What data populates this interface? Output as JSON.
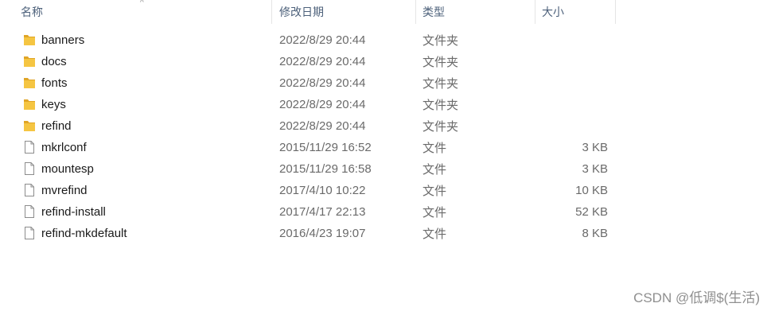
{
  "columns": {
    "name": "名称",
    "date": "修改日期",
    "type": "类型",
    "size": "大小"
  },
  "sort_indicator": "^",
  "files": [
    {
      "name": "banners",
      "date": "2022/8/29 20:44",
      "type": "文件夹",
      "size": "",
      "icon": "folder-icon"
    },
    {
      "name": "docs",
      "date": "2022/8/29 20:44",
      "type": "文件夹",
      "size": "",
      "icon": "folder-icon"
    },
    {
      "name": "fonts",
      "date": "2022/8/29 20:44",
      "type": "文件夹",
      "size": "",
      "icon": "folder-icon"
    },
    {
      "name": "keys",
      "date": "2022/8/29 20:44",
      "type": "文件夹",
      "size": "",
      "icon": "folder-icon"
    },
    {
      "name": "refind",
      "date": "2022/8/29 20:44",
      "type": "文件夹",
      "size": "",
      "icon": "folder-icon"
    },
    {
      "name": "mkrlconf",
      "date": "2015/11/29 16:52",
      "type": "文件",
      "size": "3 KB",
      "icon": "file-icon"
    },
    {
      "name": "mountesp",
      "date": "2015/11/29 16:58",
      "type": "文件",
      "size": "3 KB",
      "icon": "file-icon"
    },
    {
      "name": "mvrefind",
      "date": "2017/4/10 10:22",
      "type": "文件",
      "size": "10 KB",
      "icon": "file-icon"
    },
    {
      "name": "refind-install",
      "date": "2017/4/17 22:13",
      "type": "文件",
      "size": "52 KB",
      "icon": "file-icon"
    },
    {
      "name": "refind-mkdefault",
      "date": "2016/4/23 19:07",
      "type": "文件",
      "size": "8 KB",
      "icon": "file-icon"
    }
  ],
  "watermark": "CSDN @低调$(生活)",
  "colors": {
    "header_text": "#4c607a",
    "folder_yellow": "#f5c542",
    "folder_dark": "#e0a526"
  }
}
